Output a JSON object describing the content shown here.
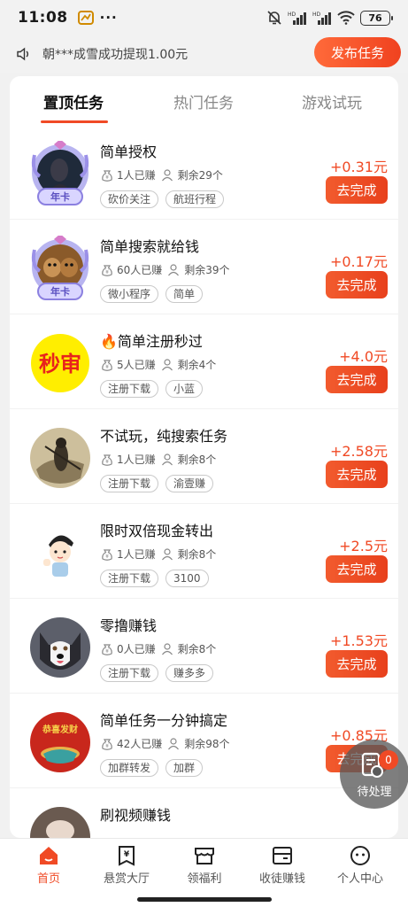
{
  "status_bar": {
    "time": "11:08",
    "battery": "76"
  },
  "notice": {
    "text": "朝***成雪成功提现1.00元",
    "publish_button": "发布任务"
  },
  "tabs": [
    {
      "label": "置顶任务",
      "active": true
    },
    {
      "label": "热门任务",
      "active": false
    },
    {
      "label": "游戏试玩",
      "active": false
    }
  ],
  "tasks": [
    {
      "title": "简单授权",
      "earned": "1人已赚",
      "remaining": "剩余29个",
      "tags": [
        "砍价关注",
        "航班行程"
      ],
      "reward": "+0.31元",
      "button": "去完成",
      "avatar": "dark-portrait-vip",
      "badge": "年卡"
    },
    {
      "title": "简单搜索就给钱",
      "earned": "60人已赚",
      "remaining": "剩余39个",
      "tags": [
        "微小程序",
        "简单"
      ],
      "reward": "+0.17元",
      "button": "去完成",
      "avatar": "dogs-vip",
      "badge": "年卡"
    },
    {
      "title": "🔥简单注册秒过",
      "earned": "5人已赚",
      "remaining": "剩余4个",
      "tags": [
        "注册下载",
        "小蓝"
      ],
      "reward": "+4.0元",
      "button": "去完成",
      "avatar": "miaoshen-logo",
      "logo_text": "秒审"
    },
    {
      "title": "不试玩，纯搜索任务",
      "earned": "1人已赚",
      "remaining": "剩余8个",
      "tags": [
        "注册下载",
        "渝壹赚"
      ],
      "reward": "+2.58元",
      "button": "去完成",
      "avatar": "ink-warrior"
    },
    {
      "title": "限时双倍现金转出",
      "earned": "1人已赚",
      "remaining": "剩余8个",
      "tags": [
        "注册下载",
        "3100"
      ],
      "reward": "+2.5元",
      "button": "去完成",
      "avatar": "cartoon-boy"
    },
    {
      "title": "零撸赚钱",
      "earned": "0人已赚",
      "remaining": "剩余8个",
      "tags": [
        "注册下载",
        "赚多多"
      ],
      "reward": "+1.53元",
      "button": "去完成",
      "avatar": "husky"
    },
    {
      "title": "简单任务一分钟搞定",
      "earned": "42人已赚",
      "remaining": "剩余98个",
      "tags": [
        "加群转发",
        "加群"
      ],
      "reward": "+0.85元",
      "button": "去完成",
      "avatar": "gongxi-facai",
      "logo_text": "恭喜发财"
    },
    {
      "title": "刷视频赚钱",
      "avatar": "partial-avatar"
    }
  ],
  "float_button": {
    "label": "待处理",
    "count": "0"
  },
  "bottom_nav": [
    {
      "label": "首页",
      "icon": "home-icon",
      "active": true
    },
    {
      "label": "悬赏大厅",
      "icon": "reward-hall-icon",
      "active": false
    },
    {
      "label": "领福利",
      "icon": "gift-store-icon",
      "active": false
    },
    {
      "label": "收徒赚钱",
      "icon": "wallet-icon",
      "active": false
    },
    {
      "label": "个人中心",
      "icon": "profile-icon",
      "active": false
    }
  ],
  "colors": {
    "accent": "#f04a25",
    "background": "#f1f1f1",
    "vip_purple": "#8b80e0"
  }
}
